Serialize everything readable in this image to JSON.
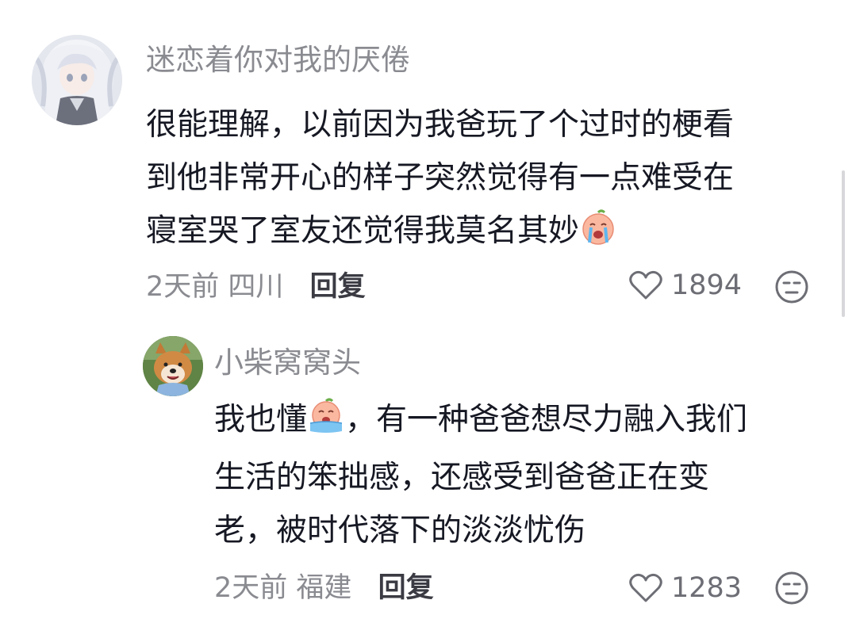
{
  "comments": [
    {
      "username": "迷恋着你对我的厌倦",
      "lines": [
        "很能理解，以前因为我爸玩了个过时的梗看",
        "到他非常开心的样子突然觉得有一点难受在",
        "寝室哭了室友还觉得我莫名其妙"
      ],
      "emoji": "crying-face-emoji",
      "time": "2天前",
      "location": "四川",
      "reply_label": "回复",
      "likes": "1894"
    },
    {
      "username": "小柴窝窝头",
      "lines": [
        "我也懂",
        "，有一种爸爸想尽力融入我们",
        "生活的笨拙感，还感受到爸爸正在变",
        "老，被时代落下的淡淡忧伤"
      ],
      "emoji": "crying-face-emoji",
      "time": "2天前",
      "location": "福建",
      "reply_label": "回复",
      "likes": "1283"
    }
  ],
  "icons": {
    "like": "heart-outline-icon",
    "dislike": "neutral-face-icon"
  },
  "colors": {
    "username": "#8a8b91",
    "text": "#161823",
    "reply": "#3a3b43"
  }
}
